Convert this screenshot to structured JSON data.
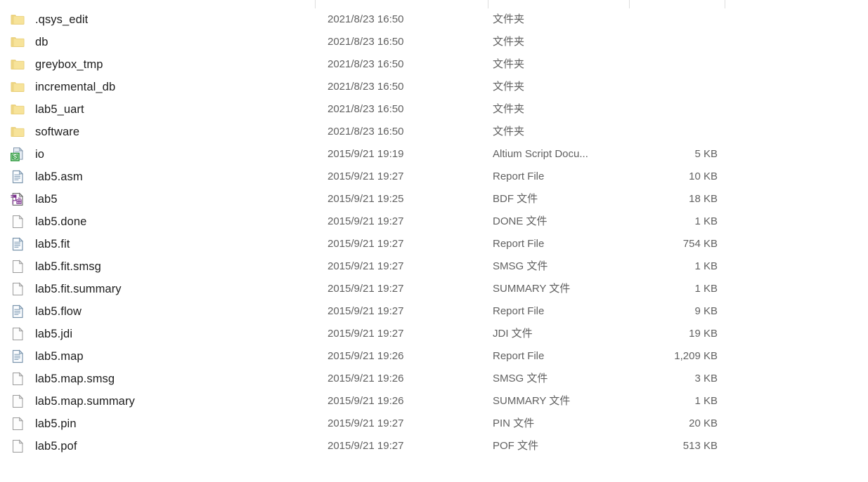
{
  "window": {
    "type": "file-explorer-details-view",
    "columns": [
      {
        "key": "name",
        "label": ""
      },
      {
        "key": "date",
        "label": ""
      },
      {
        "key": "type",
        "label": ""
      },
      {
        "key": "size",
        "label": ""
      }
    ],
    "column_dividers_x": [
      448,
      694,
      895,
      1031
    ]
  },
  "colors": {
    "folder_fill": "#f7e39a",
    "folder_tab": "#ecd27f",
    "folder_edge": "#e3c86d",
    "doc_border": "#9a9a9a",
    "report_border": "#7b95ad",
    "report_line": "#8ea7bd",
    "script_green": "#2e9b3f",
    "bdf_purple": "#7b2d8e",
    "text_primary": "#1d1d1d",
    "text_secondary": "#616161",
    "divider": "#dedede",
    "background": "#ffffff"
  },
  "files": [
    {
      "name": ".qsys_edit",
      "date": "2021/8/23 16:50",
      "type": "文件夹",
      "size": "",
      "icon": "folder-icon"
    },
    {
      "name": "db",
      "date": "2021/8/23 16:50",
      "type": "文件夹",
      "size": "",
      "icon": "folder-icon"
    },
    {
      "name": "greybox_tmp",
      "date": "2021/8/23 16:50",
      "type": "文件夹",
      "size": "",
      "icon": "folder-icon"
    },
    {
      "name": "incremental_db",
      "date": "2021/8/23 16:50",
      "type": "文件夹",
      "size": "",
      "icon": "folder-icon"
    },
    {
      "name": "lab5_uart",
      "date": "2021/8/23 16:50",
      "type": "文件夹",
      "size": "",
      "icon": "folder-icon"
    },
    {
      "name": "software",
      "date": "2021/8/23 16:50",
      "type": "文件夹",
      "size": "",
      "icon": "folder-icon"
    },
    {
      "name": "io",
      "date": "2015/9/21 19:19",
      "type": "Altium Script Docu...",
      "size": "5 KB",
      "icon": "script-document-icon"
    },
    {
      "name": "lab5.asm",
      "date": "2015/9/21 19:27",
      "type": "Report File",
      "size": "10 KB",
      "icon": "report-document-icon"
    },
    {
      "name": "lab5",
      "date": "2015/9/21 19:25",
      "type": "BDF 文件",
      "size": "18 KB",
      "icon": "bdf-schematic-icon"
    },
    {
      "name": "lab5.done",
      "date": "2015/9/21 19:27",
      "type": "DONE 文件",
      "size": "1 KB",
      "icon": "blank-document-icon"
    },
    {
      "name": "lab5.fit",
      "date": "2015/9/21 19:27",
      "type": "Report File",
      "size": "754 KB",
      "icon": "report-document-icon"
    },
    {
      "name": "lab5.fit.smsg",
      "date": "2015/9/21 19:27",
      "type": "SMSG 文件",
      "size": "1 KB",
      "icon": "blank-document-icon"
    },
    {
      "name": "lab5.fit.summary",
      "date": "2015/9/21 19:27",
      "type": "SUMMARY 文件",
      "size": "1 KB",
      "icon": "blank-document-icon"
    },
    {
      "name": "lab5.flow",
      "date": "2015/9/21 19:27",
      "type": "Report File",
      "size": "9 KB",
      "icon": "report-document-icon"
    },
    {
      "name": "lab5.jdi",
      "date": "2015/9/21 19:27",
      "type": "JDI 文件",
      "size": "19 KB",
      "icon": "blank-document-icon"
    },
    {
      "name": "lab5.map",
      "date": "2015/9/21 19:26",
      "type": "Report File",
      "size": "1,209 KB",
      "icon": "report-document-icon"
    },
    {
      "name": "lab5.map.smsg",
      "date": "2015/9/21 19:26",
      "type": "SMSG 文件",
      "size": "3 KB",
      "icon": "blank-document-icon"
    },
    {
      "name": "lab5.map.summary",
      "date": "2015/9/21 19:26",
      "type": "SUMMARY 文件",
      "size": "1 KB",
      "icon": "blank-document-icon"
    },
    {
      "name": "lab5.pin",
      "date": "2015/9/21 19:27",
      "type": "PIN 文件",
      "size": "20 KB",
      "icon": "blank-document-icon"
    },
    {
      "name": "lab5.pof",
      "date": "2015/9/21 19:27",
      "type": "POF 文件",
      "size": "513 KB",
      "icon": "blank-document-icon"
    }
  ]
}
